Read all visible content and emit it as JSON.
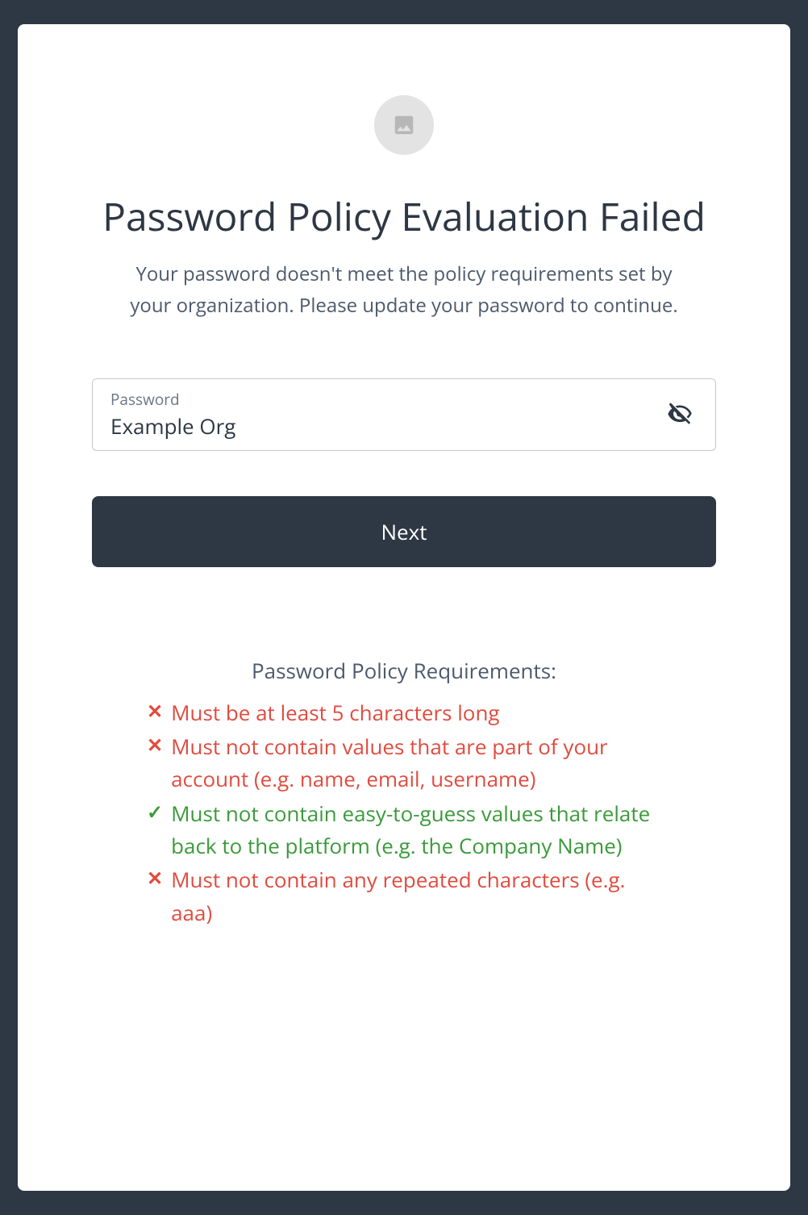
{
  "header": {
    "title": "Password Policy Evaluation Failed",
    "subtitle": "Your password doesn't meet the policy requirements set by your organization. Please update your password to continue."
  },
  "form": {
    "password_label": "Password",
    "password_value": "Example Org",
    "next_label": "Next"
  },
  "requirements": {
    "heading": "Password Policy Requirements:",
    "items": [
      {
        "status": "fail",
        "text": "Must be at least 5 characters long"
      },
      {
        "status": "fail",
        "text": "Must not contain values that are part of your account (e.g. name, email, username)"
      },
      {
        "status": "pass",
        "text": "Must not contain easy-to-guess values that relate back to the platform (e.g. the Company Name)"
      },
      {
        "status": "fail",
        "text": "Must not contain any repeated characters (e.g. aaa)"
      }
    ]
  },
  "icons": {
    "fail": "✕",
    "pass": "✓"
  }
}
